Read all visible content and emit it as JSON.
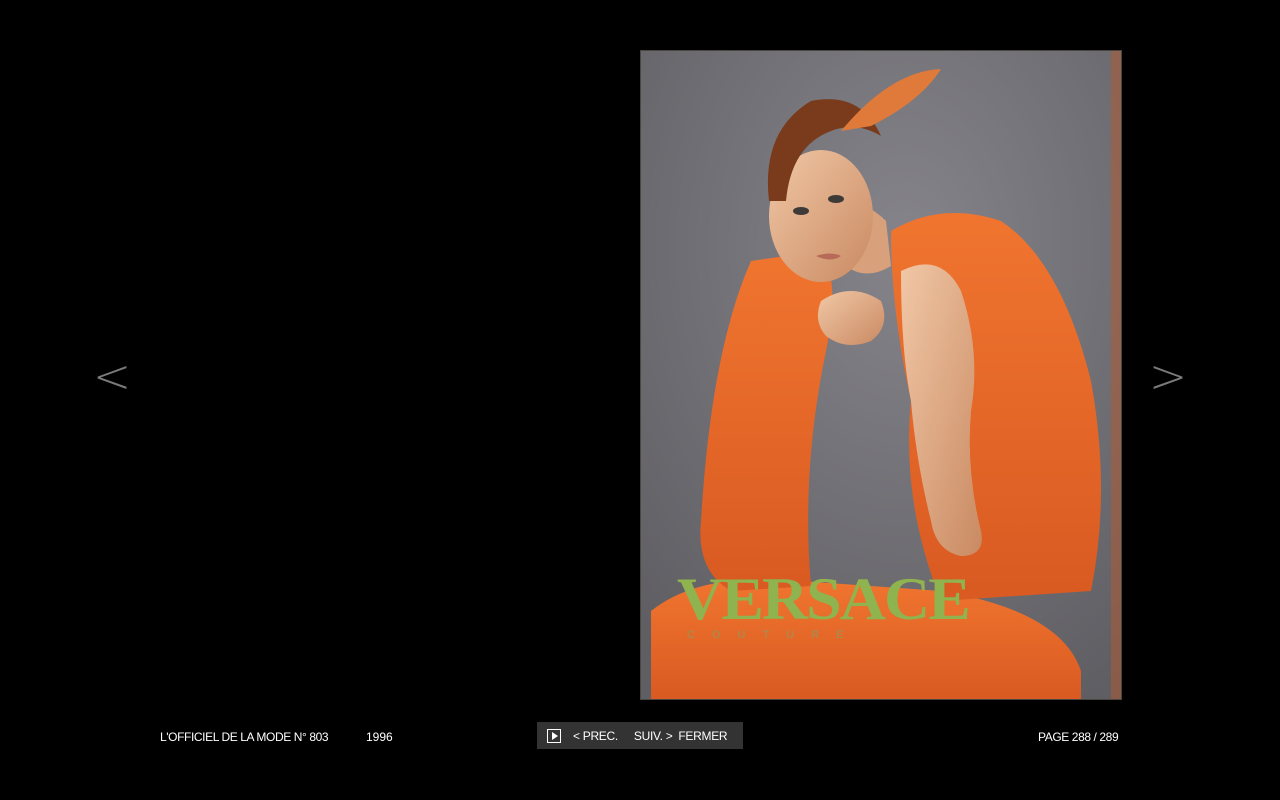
{
  "navigation": {
    "prev_arrow": "<",
    "next_arrow": ">"
  },
  "ad": {
    "brand": "VERSACE",
    "subbrand": "COUTURE",
    "brand_color": "#8fb34e",
    "dress_color": "#e06428",
    "background_color": "#6e6d72"
  },
  "footer": {
    "issue_title": "L'OFFICIEL DE LA MODE N° 803",
    "year": "1996",
    "controls": {
      "play_icon": "play-icon",
      "prev_label": "< PREC.",
      "next_label": "SUIV. >",
      "close_label": "FERMER"
    },
    "page_indicator": "PAGE 288 / 289"
  }
}
